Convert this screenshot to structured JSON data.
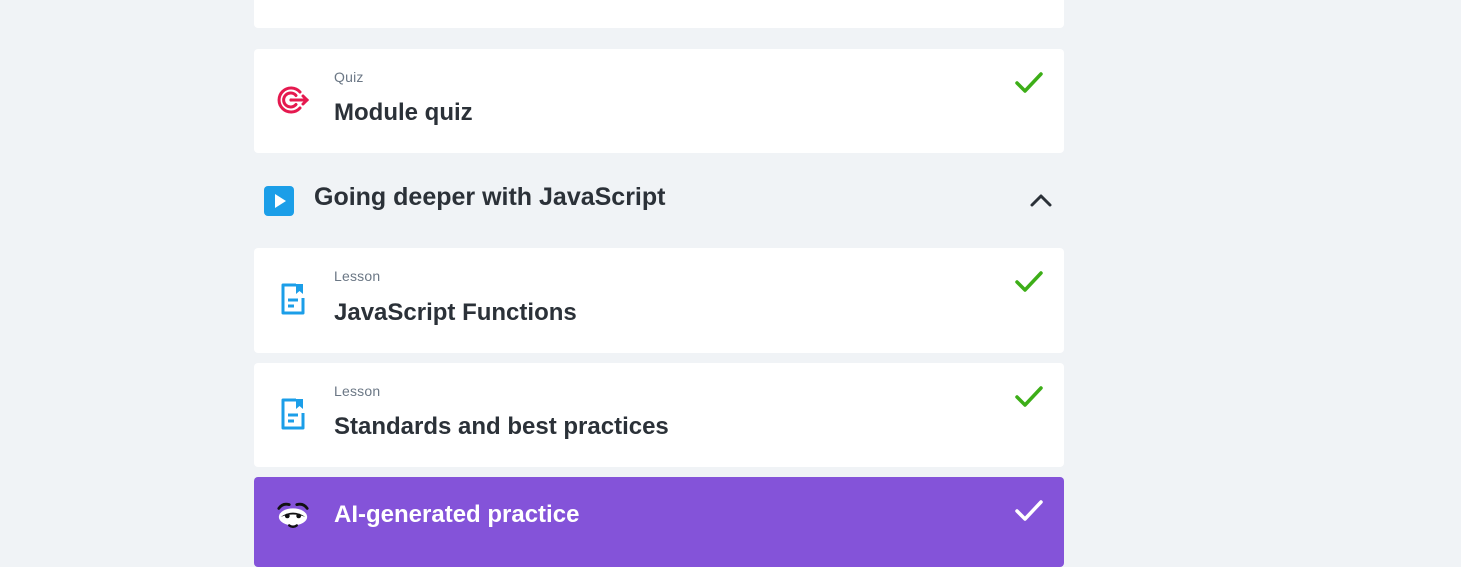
{
  "course_outline": {
    "quiz_item": {
      "type_label": "Quiz",
      "title": "Module quiz",
      "icon": "target-icon",
      "completed": true
    },
    "section": {
      "title": "Going deeper with JavaScript",
      "icon": "play-icon",
      "toggle_icon": "chevron-up-icon",
      "expanded": true
    },
    "lessons": [
      {
        "type_label": "Lesson",
        "title": "JavaScript Functions",
        "icon": "document-icon",
        "completed": true
      },
      {
        "type_label": "Lesson",
        "title": "Standards and best practices",
        "icon": "document-icon",
        "completed": true
      }
    ],
    "ai_practice": {
      "title": "AI-generated practice",
      "icon": "mascot-icon",
      "completed": true
    }
  },
  "colors": {
    "background": "#f0f3f6",
    "card": "#ffffff",
    "check_green": "#3dae18",
    "quiz_icon": "#e5194f",
    "lesson_icon": "#1b9ee8",
    "play_icon_bg": "#1b9ee8",
    "ai_card_bg": "#8453d9",
    "text_dark": "#2b3138",
    "text_muted": "#6b7785"
  }
}
